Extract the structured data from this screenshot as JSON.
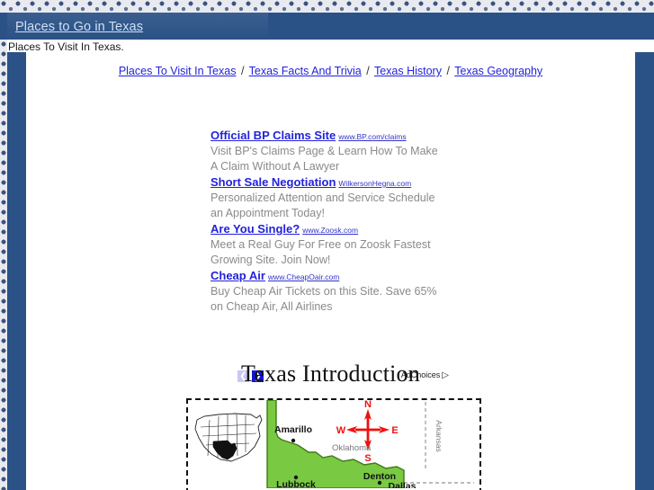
{
  "header": {
    "site_title": "Places to Go in Texas",
    "tagline": "Places To Visit In Texas."
  },
  "nav": {
    "separator": "/",
    "links": [
      {
        "label": "Places To Visit In Texas"
      },
      {
        "label": "Texas Facts And Trivia"
      },
      {
        "label": "Texas History"
      },
      {
        "label": "Texas Geography"
      }
    ]
  },
  "ads": {
    "items": [
      {
        "title": "Official BP Claims Site",
        "url": "www.BP.com/claims",
        "desc": "Visit BP's Claims Page & Learn How To Make A Claim Without A Lawyer"
      },
      {
        "title": "Short Sale Negotiation",
        "url": "WilkersonHegna.com",
        "desc": "Personalized Attention and Service Schedule an Appointment Today!"
      },
      {
        "title": "Are You Single?",
        "url": "www.Zoosk.com",
        "desc": "Meet a Real Guy For Free on Zoosk Fastest Growing Site. Join Now!"
      },
      {
        "title": "Cheap Air",
        "url": "www.CheapOair.com",
        "desc": "Buy Cheap Air Tickets on this Site. Save 65% on Cheap Air, All Airlines"
      }
    ],
    "prev_label": "❮",
    "next_label": "❯",
    "adchoices_label": "AdChoices",
    "adchoices_icon": "▷"
  },
  "main": {
    "heading": "Texas Introduction"
  },
  "map": {
    "state_fill": "#7ac943",
    "compass_color": "#ee1111",
    "labels": {
      "compass_n": "N",
      "compass_e": "E",
      "compass_s": "S",
      "compass_w": "W",
      "oklahoma": "Oklahoma",
      "arkansas": "Arkansas"
    },
    "cities": [
      {
        "name": "Amarillo"
      },
      {
        "name": "Lubbock"
      },
      {
        "name": "Denton"
      },
      {
        "name": "Dallas"
      }
    ]
  },
  "colors": {
    "header_blue": "#2b5286",
    "link_blue": "#2222dd",
    "ad_text_gray": "#8a8a8a"
  }
}
